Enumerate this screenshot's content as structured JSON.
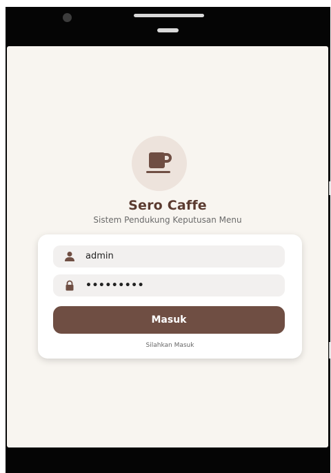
{
  "app": {
    "title": "Sero Caffe",
    "subtitle": "Sistem Pendukung Keputusan Menu",
    "logo_icon": "coffee-cup-icon"
  },
  "login": {
    "username_value": "admin",
    "username_icon": "user-icon",
    "password_value": "•••••••••",
    "password_icon": "lock-icon",
    "submit_label": "Masuk",
    "hint": "Silahkan Masuk"
  },
  "colors": {
    "brand": "#6f4e43",
    "title": "#5b3b30",
    "screen_bg": "#f8f5f0",
    "logo_bg": "#ede3dc",
    "field_bg": "#f2f0ef"
  }
}
